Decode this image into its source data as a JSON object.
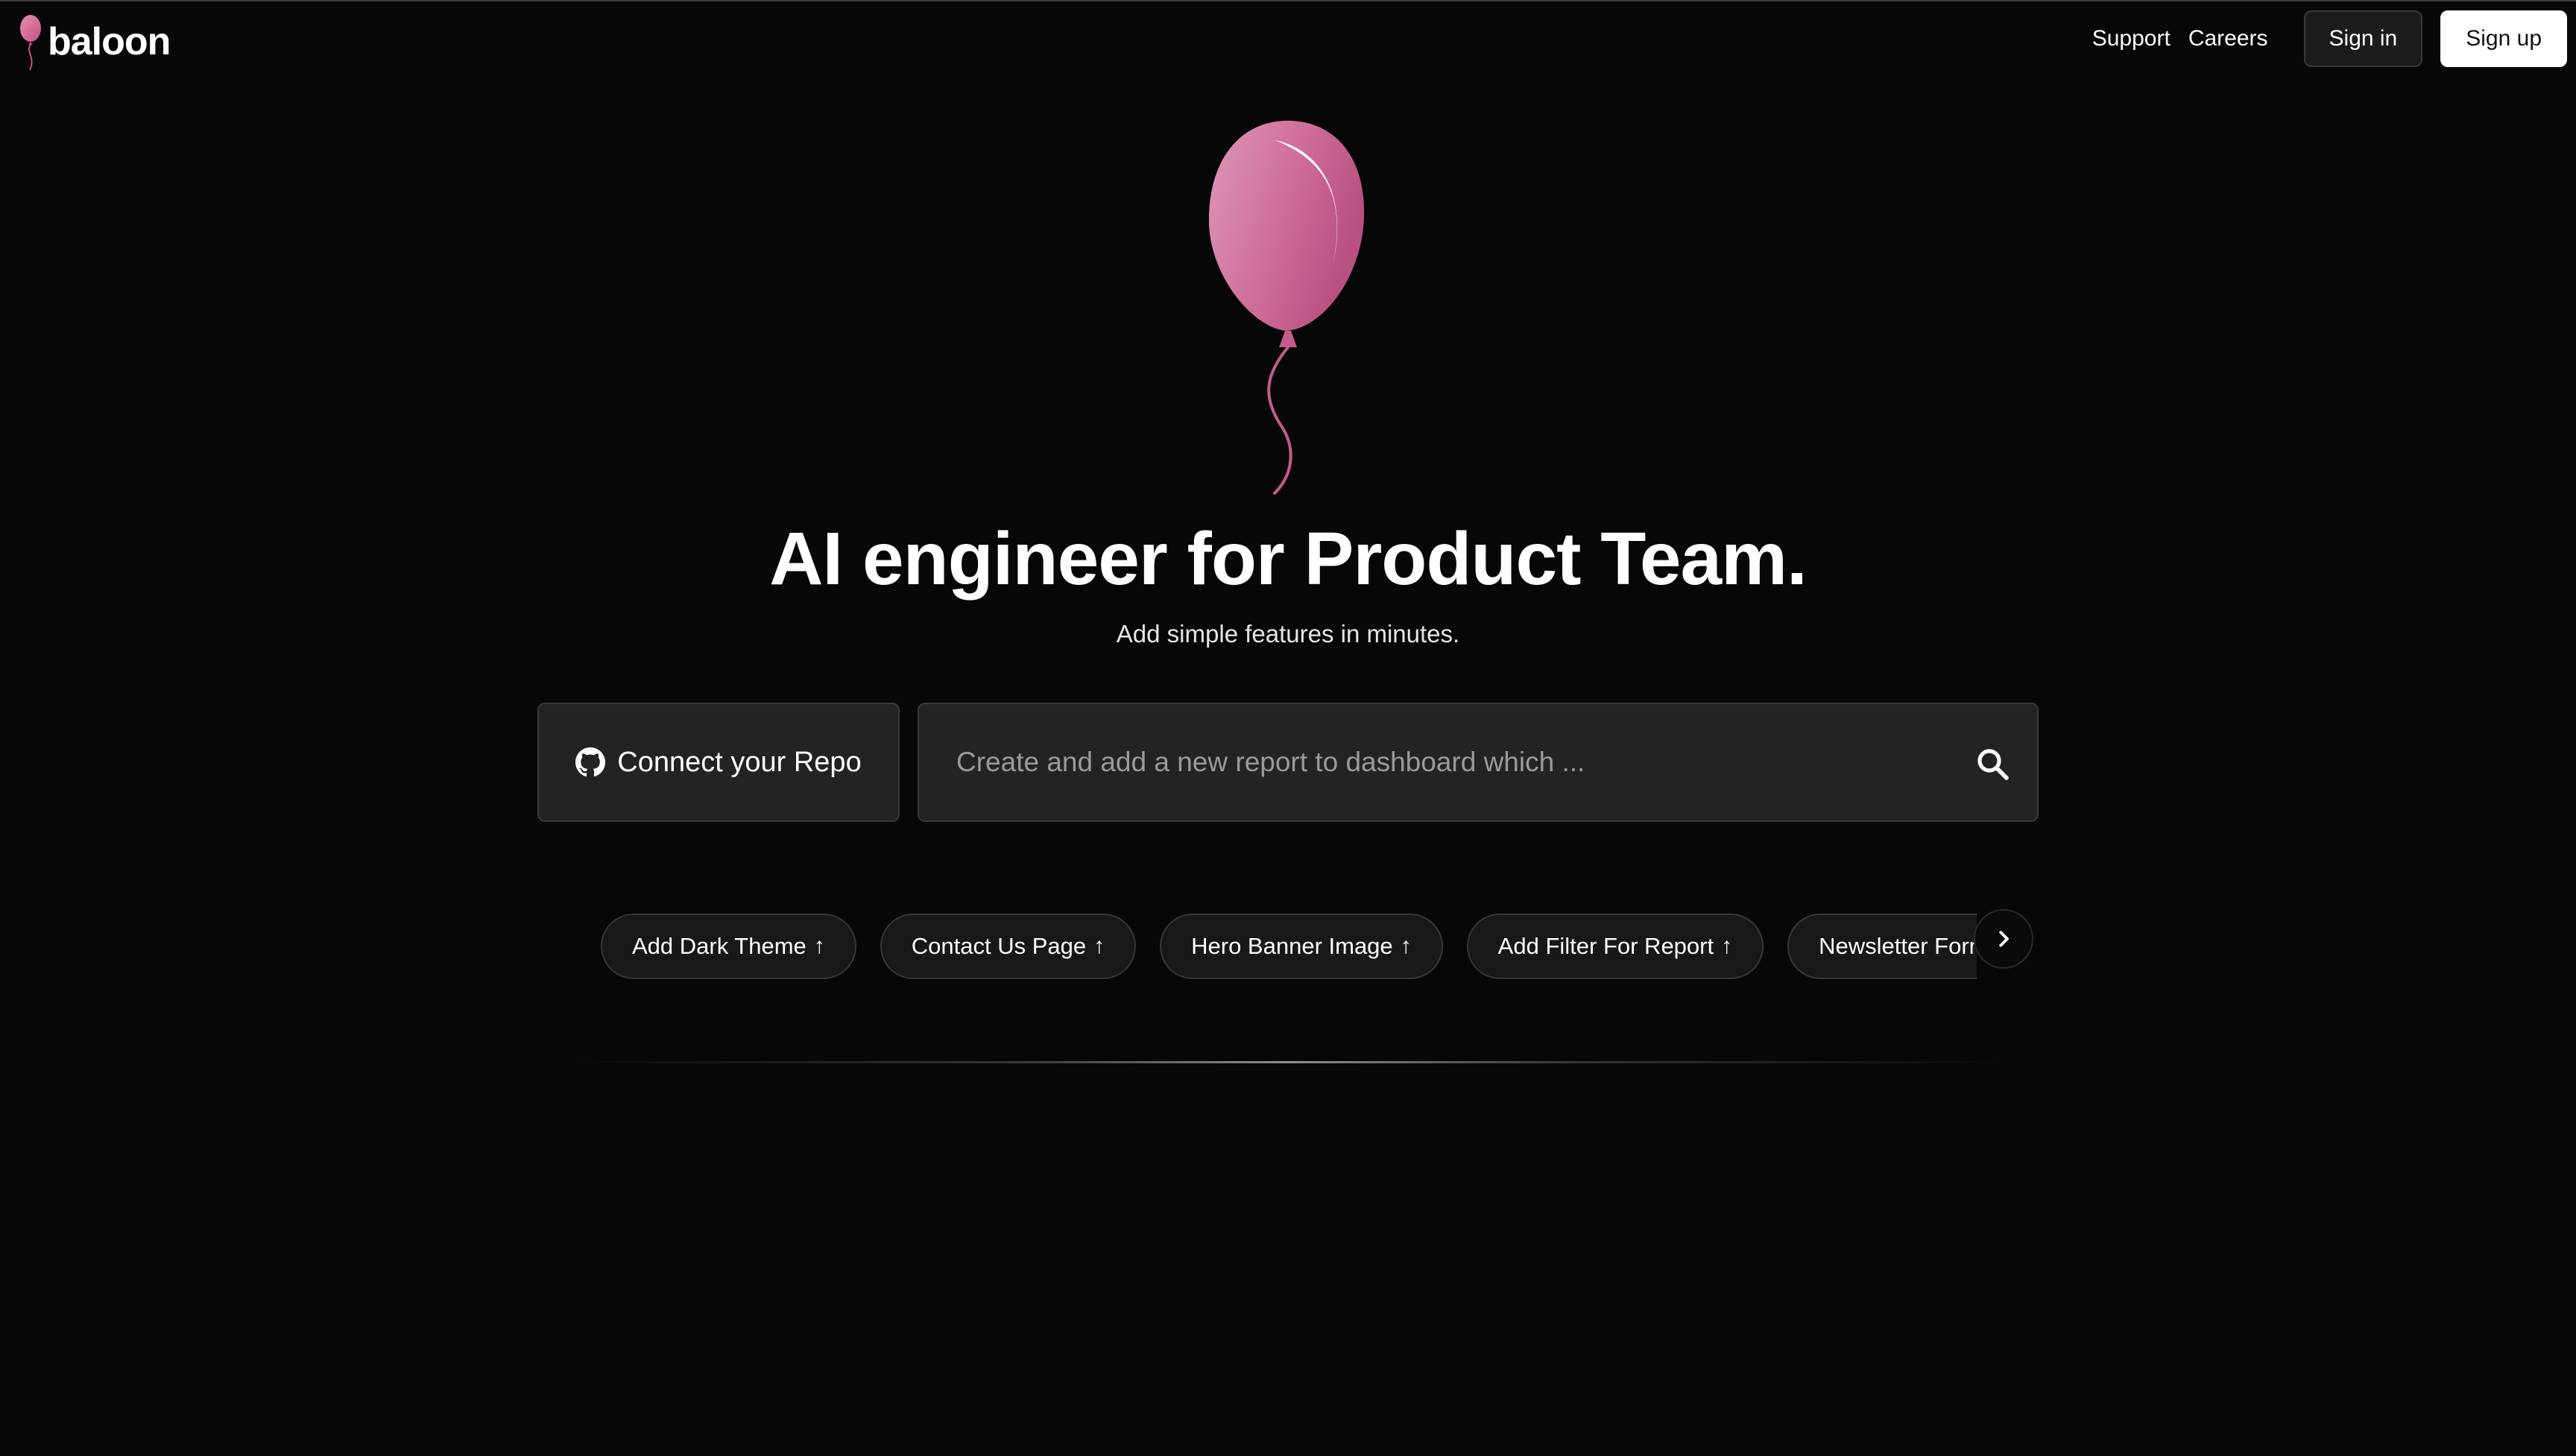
{
  "header": {
    "logo_text": "baloon",
    "nav": {
      "support": "Support",
      "careers": "Careers",
      "sign_in": "Sign in",
      "sign_up": "Sign up"
    }
  },
  "hero": {
    "headline": "AI engineer for Product Team.",
    "subheadline": "Add simple features in minutes.",
    "balloon_icon": "balloon-icon"
  },
  "actions": {
    "connect_repo_label": "Connect your Repo",
    "connect_repo_icon": "github-icon",
    "search_placeholder": "Create and add a new report to dashboard which ...",
    "search_icon": "search-icon"
  },
  "suggestions": [
    {
      "label": "Add Dark Theme",
      "arrow": "↑"
    },
    {
      "label": "Contact Us Page",
      "arrow": "↑"
    },
    {
      "label": "Hero Banner Image",
      "arrow": "↑"
    },
    {
      "label": "Add Filter For Report",
      "arrow": "↑"
    },
    {
      "label": "Newsletter Form",
      "arrow": "↑"
    }
  ],
  "colors": {
    "background": "#080707",
    "balloon_pink": "#d4709a",
    "panel": "#232323",
    "border": "#3a3a3a"
  }
}
